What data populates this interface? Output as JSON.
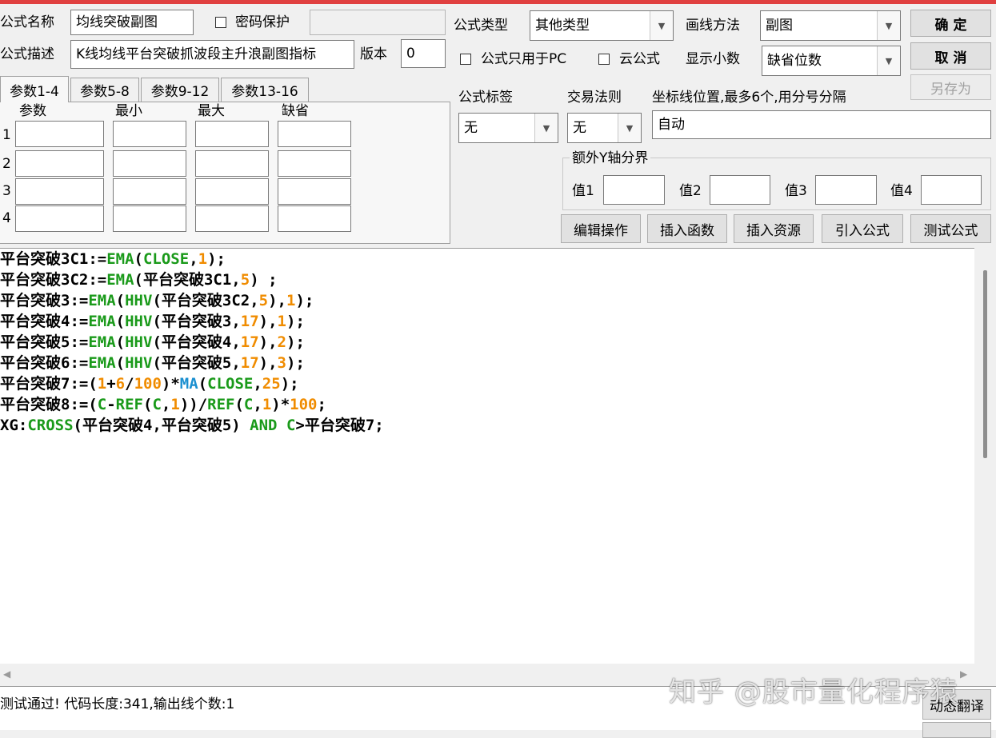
{
  "form": {
    "name_label": "公式名称",
    "name_value": "均线突破副图",
    "password_label": "密码保护",
    "desc_label": "公式描述",
    "desc_value": "K线均线平台突破抓波段主升浪副图指标",
    "version_label": "版本",
    "version_value": "0",
    "type_label": "公式类型",
    "type_value": "其他类型",
    "draw_label": "画线方法",
    "draw_value": "副图",
    "pc_only_label": "公式只用于PC",
    "cloud_label": "云公式",
    "decimal_label": "显示小数",
    "decimal_value": "缺省位数",
    "tag_label": "公式标签",
    "tag_value": "无",
    "rule_label": "交易法则",
    "rule_value": "无",
    "axis_label": "坐标线位置,最多6个,用分号分隔",
    "axis_value": "自动",
    "extra_y_label": "额外Y轴分界",
    "y_values": [
      "值1",
      "值2",
      "值3",
      "值4"
    ]
  },
  "buttons": {
    "ok": "确  定",
    "cancel": "取  消",
    "save_as": "另存为",
    "edit_ops": "编辑操作",
    "insert_func": "插入函数",
    "insert_res": "插入资源",
    "import_formula": "引入公式",
    "test_formula": "测试公式",
    "dynamic_translate": "动态翻译"
  },
  "tabs": [
    "参数1-4",
    "参数5-8",
    "参数9-12",
    "参数13-16"
  ],
  "params": {
    "headers": [
      "参数",
      "最小",
      "最大",
      "缺省"
    ],
    "rows": [
      "1",
      "2",
      "3",
      "4"
    ]
  },
  "code_lines": [
    [
      [
        "平台突破3C1:=",
        "#000000"
      ],
      [
        "EMA",
        "#1a9a1a"
      ],
      [
        "(",
        "#000000"
      ],
      [
        "CLOSE",
        "#1a9a1a"
      ],
      [
        ",",
        "#000000"
      ],
      [
        "1",
        "#f08c00"
      ],
      [
        ");",
        "#000000"
      ]
    ],
    [
      [
        "平台突破3C2:=",
        "#000000"
      ],
      [
        "EMA",
        "#1a9a1a"
      ],
      [
        "(平台突破3C1,",
        "#000000"
      ],
      [
        "5",
        "#f08c00"
      ],
      [
        ") ;",
        "#000000"
      ]
    ],
    [
      [
        "平台突破3:=",
        "#000000"
      ],
      [
        "EMA",
        "#1a9a1a"
      ],
      [
        "(",
        "#000000"
      ],
      [
        "HHV",
        "#1a9a1a"
      ],
      [
        "(平台突破3C2,",
        "#000000"
      ],
      [
        "5",
        "#f08c00"
      ],
      [
        "),",
        "#000000"
      ],
      [
        "1",
        "#f08c00"
      ],
      [
        ");",
        "#000000"
      ]
    ],
    [
      [
        "平台突破4:=",
        "#000000"
      ],
      [
        "EMA",
        "#1a9a1a"
      ],
      [
        "(",
        "#000000"
      ],
      [
        "HHV",
        "#1a9a1a"
      ],
      [
        "(平台突破3,",
        "#000000"
      ],
      [
        "17",
        "#f08c00"
      ],
      [
        "),",
        "#000000"
      ],
      [
        "1",
        "#f08c00"
      ],
      [
        ");",
        "#000000"
      ]
    ],
    [
      [
        "平台突破5:=",
        "#000000"
      ],
      [
        "EMA",
        "#1a9a1a"
      ],
      [
        "(",
        "#000000"
      ],
      [
        "HHV",
        "#1a9a1a"
      ],
      [
        "(平台突破4,",
        "#000000"
      ],
      [
        "17",
        "#f08c00"
      ],
      [
        "),",
        "#000000"
      ],
      [
        "2",
        "#f08c00"
      ],
      [
        ");",
        "#000000"
      ]
    ],
    [
      [
        "平台突破6:=",
        "#000000"
      ],
      [
        "EMA",
        "#1a9a1a"
      ],
      [
        "(",
        "#000000"
      ],
      [
        "HHV",
        "#1a9a1a"
      ],
      [
        "(平台突破5,",
        "#000000"
      ],
      [
        "17",
        "#f08c00"
      ],
      [
        "),",
        "#000000"
      ],
      [
        "3",
        "#f08c00"
      ],
      [
        ");",
        "#000000"
      ]
    ],
    [
      [
        "平台突破7:=(",
        "#000000"
      ],
      [
        "1",
        "#f08c00"
      ],
      [
        "+",
        "#000000"
      ],
      [
        "6",
        "#f08c00"
      ],
      [
        "/",
        "#000000"
      ],
      [
        "100",
        "#f08c00"
      ],
      [
        ")*",
        "#000000"
      ],
      [
        "MA",
        "#1a8fd0"
      ],
      [
        "(",
        "#000000"
      ],
      [
        "CLOSE",
        "#1a9a1a"
      ],
      [
        ",",
        "#000000"
      ],
      [
        "25",
        "#f08c00"
      ],
      [
        ");",
        "#000000"
      ]
    ],
    [
      [
        "平台突破8:=(",
        "#000000"
      ],
      [
        "C",
        "#1a9a1a"
      ],
      [
        "-",
        "#000000"
      ],
      [
        "REF",
        "#1a9a1a"
      ],
      [
        "(",
        "#000000"
      ],
      [
        "C",
        "#1a9a1a"
      ],
      [
        ",",
        "#000000"
      ],
      [
        "1",
        "#f08c00"
      ],
      [
        "))/",
        "#000000"
      ],
      [
        "REF",
        "#1a9a1a"
      ],
      [
        "(",
        "#000000"
      ],
      [
        "C",
        "#1a9a1a"
      ],
      [
        ",",
        "#000000"
      ],
      [
        "1",
        "#f08c00"
      ],
      [
        ")*",
        "#000000"
      ],
      [
        "100",
        "#f08c00"
      ],
      [
        ";",
        "#000000"
      ]
    ],
    [
      [
        "XG:",
        "#000000"
      ],
      [
        "CROSS",
        "#1a9a1a"
      ],
      [
        "(平台突破4,平台突破5) ",
        "#000000"
      ],
      [
        "AND",
        "#1a9a1a"
      ],
      [
        " ",
        "#000000"
      ],
      [
        "C",
        "#1a9a1a"
      ],
      [
        ">平台突破7;",
        "#000000"
      ]
    ]
  ],
  "status": "测试通过! 代码长度:341,输出线个数:1",
  "watermark": "知乎 @股市量化程序猿",
  "colors": {
    "keyword": "#1a9a1a",
    "number": "#f08c00",
    "function_ma": "#1a8fd0",
    "title_bar": "#e04040"
  }
}
